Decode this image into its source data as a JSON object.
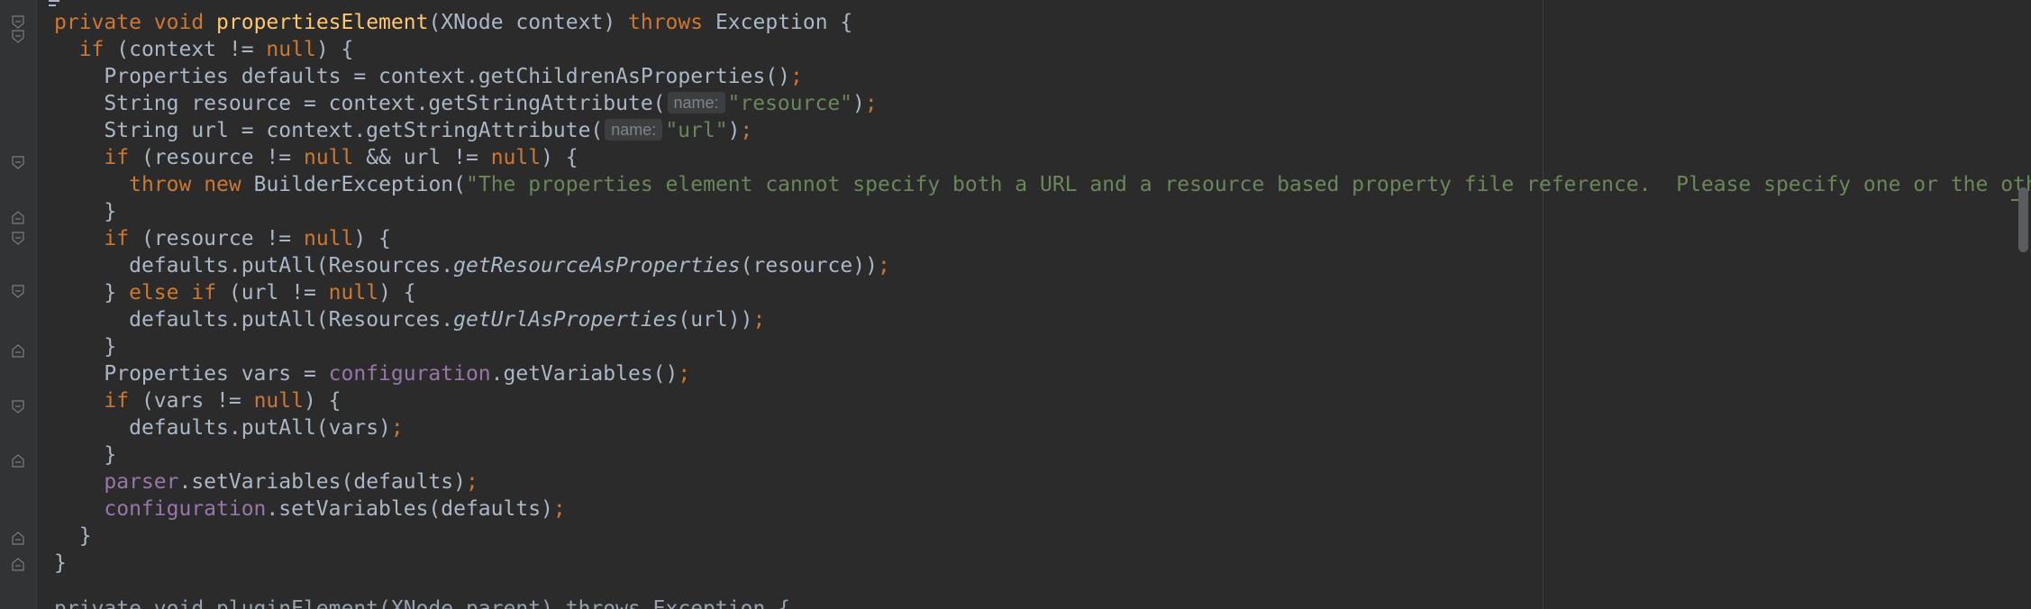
{
  "editor": {
    "colors": {
      "background": "#2b2b2b",
      "gutter": "#313335",
      "keyword": "#cc7832",
      "method_decl": "#ffc66d",
      "string": "#6a8759",
      "field": "#9876aa",
      "default": "#a9b7c6",
      "param_hint_bg": "#3b3f42",
      "param_hint_fg": "#7f8287"
    },
    "fold_markers": [
      1,
      2,
      6,
      9,
      10,
      12,
      15,
      16,
      18,
      21,
      22
    ],
    "code": {
      "l1": {
        "kw_private": "private",
        "kw_void": "void",
        "method": "propertiesElement",
        "params": "(XNode context) ",
        "kw_throws": "throws",
        "rest": " Exception {"
      },
      "l2": {
        "kw_if": "if",
        "rest_a": " (context != ",
        "kw_null": "null",
        "rest_b": ") {"
      },
      "l3": {
        "text": "Properties defaults = context.getChildrenAsProperties()",
        "semi": ";"
      },
      "l4": {
        "text": "String resource = context.getStringAttribute(",
        "hint": "name:",
        "str": "\"resource\"",
        "close": ")",
        "semi": ";"
      },
      "l5": {
        "text": "String url = context.getStringAttribute(",
        "hint": "name:",
        "str": "\"url\"",
        "close": ")",
        "semi": ";"
      },
      "l6": {
        "kw_if": "if",
        "a": " (resource != ",
        "null1": "null",
        "b": " && url != ",
        "null2": "null",
        "c": ") {"
      },
      "l7": {
        "kw_throw": "throw",
        "kw_new": "new",
        "cls": " BuilderException(",
        "str": "\"The properties element cannot specify both a URL and a resource based property file reference.  Please specify one or the other.\""
      },
      "l8": {
        "text": "}"
      },
      "l9": {
        "kw_if": "if",
        "a": " (resource != ",
        "kw_null": "null",
        "b": ") {"
      },
      "l10": {
        "a": "defaults.putAll(Resources.",
        "static": "getResourceAsProperties",
        "b": "(resource))",
        "semi": ";"
      },
      "l11": {
        "a": "} ",
        "kw_else": "else",
        "kw_if": "if",
        "b": " (url != ",
        "kw_null": "null",
        "c": ") {"
      },
      "l12": {
        "a": "defaults.putAll(Resources.",
        "static": "getUrlAsProperties",
        "b": "(url))",
        "semi": ";"
      },
      "l13": {
        "text": "}"
      },
      "l14": {
        "a": "Properties vars = ",
        "field": "configuration",
        "b": ".getVariables()",
        "semi": ";"
      },
      "l15": {
        "kw_if": "if",
        "a": " (vars != ",
        "kw_null": "null",
        "b": ") {"
      },
      "l16": {
        "text": "defaults.putAll(vars)",
        "semi": ";"
      },
      "l17": {
        "text": "}"
      },
      "l18": {
        "field": "parser",
        "b": ".setVariables(defaults)",
        "semi": ";"
      },
      "l19": {
        "field": "configuration",
        "b": ".setVariables(defaults)",
        "semi": ";"
      },
      "l20": {
        "text": "}"
      },
      "l21": {
        "text": "}"
      }
    },
    "ghost_next_line": "private void pluginElement(XNode parent) throws Exception {"
  }
}
